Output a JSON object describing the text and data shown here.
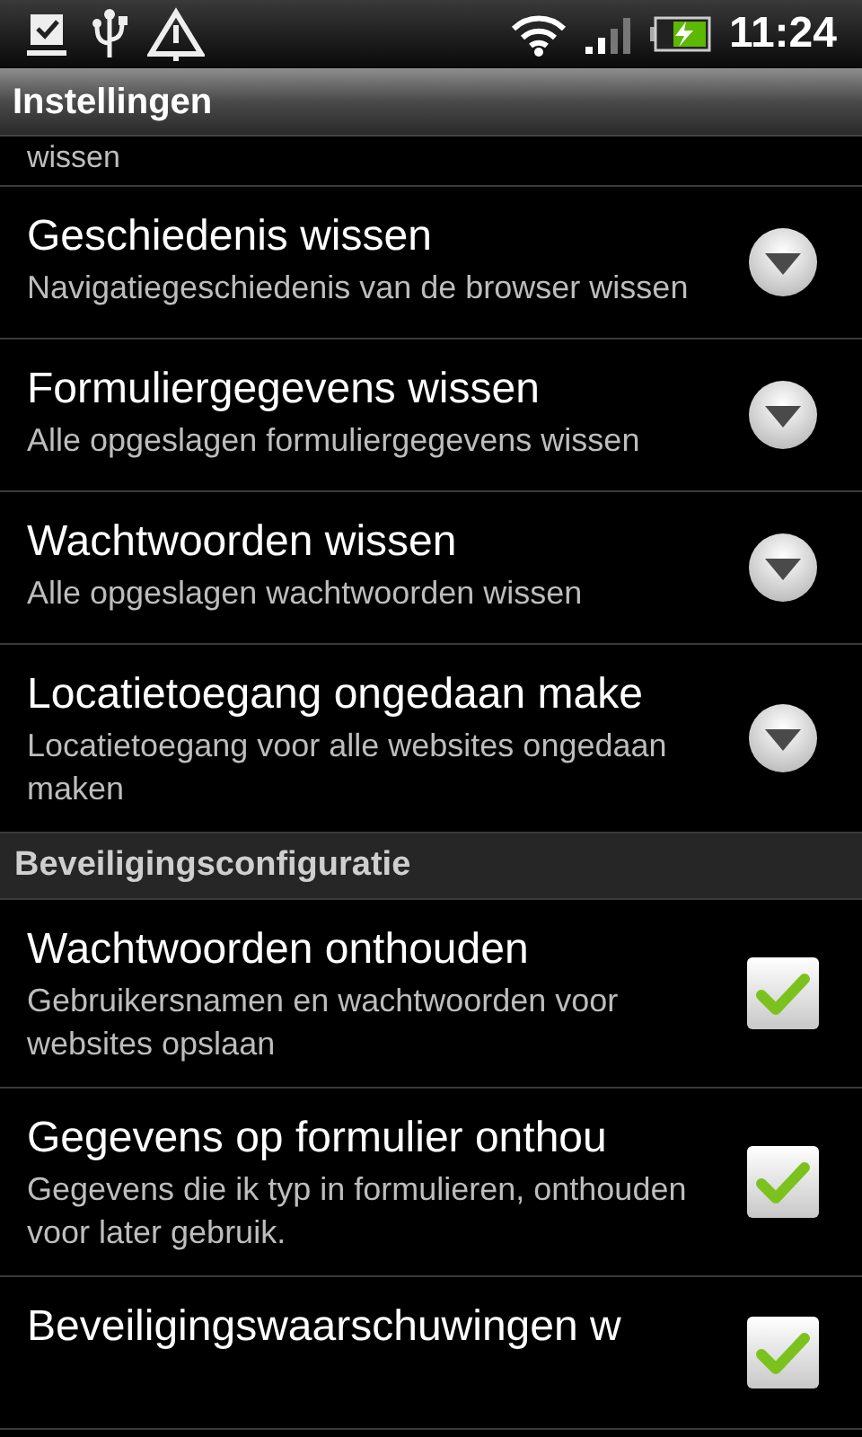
{
  "status_bar": {
    "time": "11:24"
  },
  "title": "Instellingen",
  "top_fragment": "wissen",
  "sections": [
    {
      "items": [
        {
          "kind": "action",
          "title": "Geschiedenis wissen",
          "summary": "Navigatiegeschiedenis van de browser wissen"
        },
        {
          "kind": "action",
          "title": "Formuliergegevens wissen",
          "summary": "Alle opgeslagen formuliergegevens wissen"
        },
        {
          "kind": "action",
          "title": "Wachtwoorden wissen",
          "summary": "Alle opgeslagen wachtwoorden wissen"
        },
        {
          "kind": "action",
          "title": "Locatietoegang ongedaan make",
          "summary": "Locatietoegang voor alle websites ongedaan maken"
        }
      ]
    },
    {
      "header": "Beveiligingsconfiguratie",
      "items": [
        {
          "kind": "checkbox",
          "title": "Wachtwoorden onthouden",
          "summary": "Gebruikersnamen en wachtwoorden voor websites opslaan",
          "checked": true
        },
        {
          "kind": "checkbox",
          "title": "Gegevens op formulier onthou",
          "summary": "Gegevens die ik typ in formulieren, onthouden voor later gebruik.",
          "checked": true
        },
        {
          "kind": "checkbox",
          "title": "Beveiligingswaarschuwingen w",
          "checked": true
        }
      ]
    }
  ]
}
